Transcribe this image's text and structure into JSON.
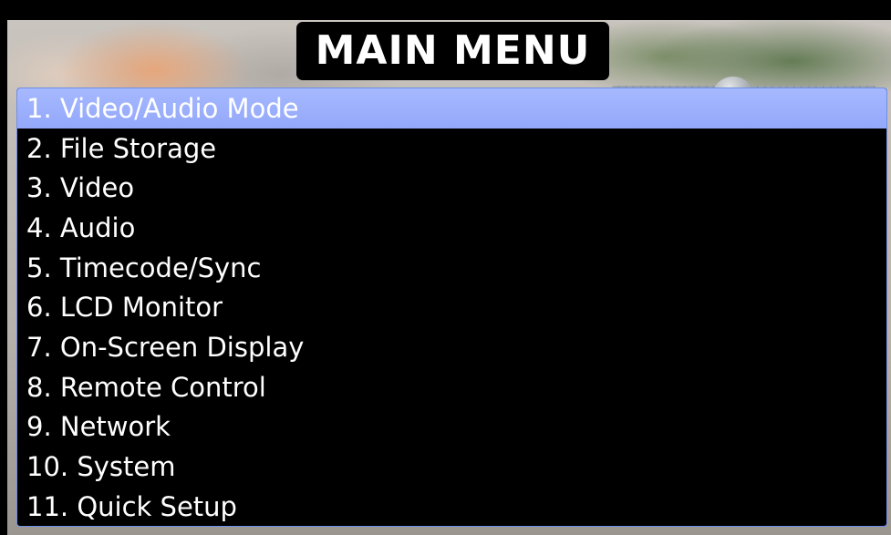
{
  "header": {
    "title": "MAIN MENU"
  },
  "menu": {
    "selected_index": 0,
    "items": [
      {
        "label": "1. Video/Audio Mode"
      },
      {
        "label": "2. File Storage"
      },
      {
        "label": "3. Video"
      },
      {
        "label": "4. Audio"
      },
      {
        "label": "5. Timecode/Sync"
      },
      {
        "label": "6. LCD Monitor"
      },
      {
        "label": "7. On-Screen Display"
      },
      {
        "label": "8. Remote Control"
      },
      {
        "label": "9. Network"
      },
      {
        "label": "10. System"
      },
      {
        "label": "11. Quick Setup"
      }
    ]
  },
  "colors": {
    "selection": "#9aadfc",
    "menu_border": "#6f8ee8",
    "text": "#ffffff",
    "menu_background": "#000000"
  }
}
